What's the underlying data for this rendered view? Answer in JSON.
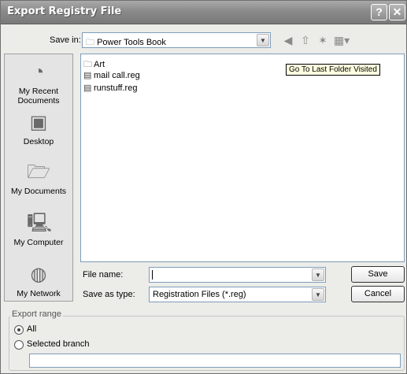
{
  "window": {
    "title": "Export Registry File",
    "help_icon": "help-icon",
    "close_icon": "close-icon"
  },
  "toolbar": {
    "save_in_label": "Save in:",
    "save_in_value": "Power Tools Book",
    "icons": [
      "back-icon",
      "up-folder-icon",
      "new-folder-icon",
      "views-icon"
    ]
  },
  "places": [
    {
      "label": "My Recent Documents",
      "icon": "recent-documents-icon"
    },
    {
      "label": "Desktop",
      "icon": "desktop-icon"
    },
    {
      "label": "My Documents",
      "icon": "my-documents-icon"
    },
    {
      "label": "My Computer",
      "icon": "my-computer-icon"
    },
    {
      "label": "My Network",
      "icon": "my-network-icon"
    }
  ],
  "files": [
    {
      "name": "Art",
      "icon": "folder-icon"
    },
    {
      "name": "mail call.reg",
      "icon": "reg-file-icon"
    },
    {
      "name": "runstuff.reg",
      "icon": "reg-file-icon"
    }
  ],
  "tooltip": "Go To Last Folder Visited",
  "form": {
    "file_name_label": "File name:",
    "file_name_value": "",
    "save_as_type_label": "Save as type:",
    "save_as_type_value": "Registration Files (*.reg)",
    "save_button": "Save",
    "cancel_button": "Cancel"
  },
  "export_range": {
    "legend": "Export range",
    "all_label": "All",
    "selected_branch_label": "Selected branch",
    "selected_option": "All",
    "branch_value": ""
  }
}
